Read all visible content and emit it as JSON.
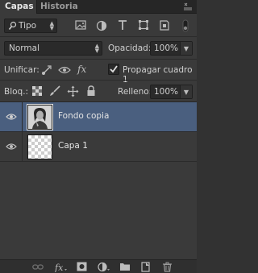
{
  "tabs": [
    {
      "label": "Capas"
    },
    {
      "label": "Historia"
    }
  ],
  "filter": {
    "value": "Tipo"
  },
  "blend": {
    "value": "Normal",
    "opacity_label": "Opacidad:",
    "opacity_value": "100%"
  },
  "unify": {
    "label": "Unificar:",
    "propagate_label": "Propagar cuadro 1",
    "propagate_checked": true
  },
  "lock": {
    "label": "Bloq.:",
    "fill_label": "Relleno:",
    "fill_value": "100%"
  },
  "layers": [
    {
      "name": "Fondo copia",
      "selected": true,
      "thumbnail": "photo"
    },
    {
      "name": "Capa 1",
      "selected": false,
      "thumbnail": "transparent"
    }
  ],
  "colors": {
    "selection": "#4a5f7f",
    "panel": "#3a3a3a"
  }
}
